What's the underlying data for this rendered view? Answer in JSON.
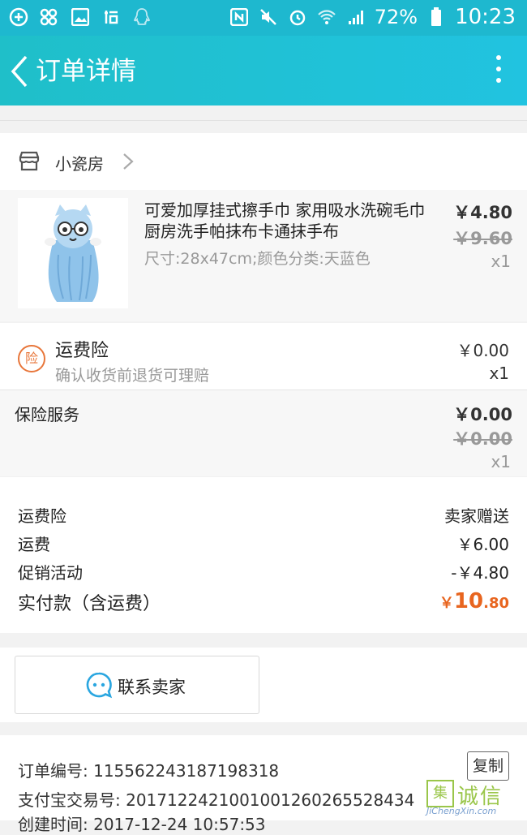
{
  "status_bar": {
    "battery": "72%",
    "time": "10:23",
    "colors": {
      "bg": "#1eb8cf"
    }
  },
  "header": {
    "title": "订单详情",
    "colors": {
      "gradient_start": "#1fbfc9",
      "gradient_end": "#21c3e0"
    }
  },
  "shop": {
    "name": "小瓷房"
  },
  "item": {
    "title": "可爱加厚挂式擦手巾 家用吸水洗碗毛巾厨房洗手帕抹布卡通抹手布",
    "spec": "尺寸:28x47cm;颜色分类:天蓝色",
    "price": "￥4.80",
    "original_price": "￥9.60",
    "quantity": "x1"
  },
  "shipping_insurance": {
    "badge": "险",
    "name": "运费险",
    "description": "确认收货前退货可理赔",
    "price": "￥0.00",
    "quantity": "x1"
  },
  "insurance_service": {
    "name": "保险服务",
    "price": "￥0.00",
    "original_price": "￥0.00",
    "quantity": "x1"
  },
  "summary": {
    "rows": [
      {
        "label": "运费险",
        "value": "卖家赠送"
      },
      {
        "label": "运费",
        "value": "￥6.00"
      },
      {
        "label": "促销活动",
        "value": "-￥4.80"
      }
    ],
    "total_label": "实付款（含运费）",
    "total_currency": "￥",
    "total_integer": "10",
    "total_decimal": ".80",
    "accent": "#e8651f"
  },
  "actions": {
    "contact_seller": "联系卖家"
  },
  "order_info": {
    "order_no": "订单编号: 1155622431871983​18",
    "alipay_no": "支付宝交易号: 2017122421001001260265528434",
    "created": "创建时间: 2017-12-24 10:57:53",
    "copy_label": "复制"
  },
  "watermark": {
    "mark": "集",
    "text": "诚信",
    "url": "JiChengXin.com"
  }
}
